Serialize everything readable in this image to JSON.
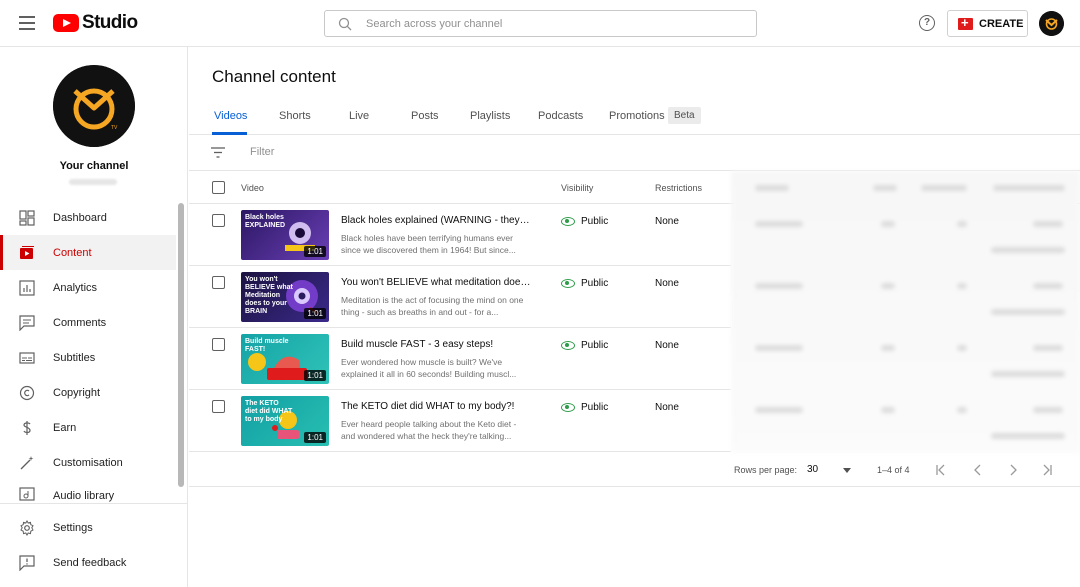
{
  "header": {
    "logo_text": "Studio",
    "search_placeholder": "Search across your channel",
    "create_label": "CREATE",
    "help_glyph": "?"
  },
  "sidebar": {
    "channel_name": "Your channel",
    "items": [
      {
        "label": "Dashboard",
        "icon": "dashboard-icon"
      },
      {
        "label": "Content",
        "icon": "content-icon",
        "active": true
      },
      {
        "label": "Analytics",
        "icon": "analytics-icon"
      },
      {
        "label": "Comments",
        "icon": "comments-icon"
      },
      {
        "label": "Subtitles",
        "icon": "subtitles-icon"
      },
      {
        "label": "Copyright",
        "icon": "copyright-icon"
      },
      {
        "label": "Earn",
        "icon": "earn-icon"
      },
      {
        "label": "Customisation",
        "icon": "customisation-icon"
      },
      {
        "label": "Audio library",
        "icon": "audio-library-icon"
      }
    ],
    "bottom_items": [
      {
        "label": "Settings",
        "icon": "gear-icon"
      },
      {
        "label": "Send feedback",
        "icon": "feedback-icon"
      }
    ]
  },
  "main": {
    "title": "Channel content",
    "tabs": [
      "Videos",
      "Shorts",
      "Live",
      "Posts",
      "Playlists",
      "Podcasts",
      "Promotions"
    ],
    "beta_label": "Beta",
    "filter_placeholder": "Filter",
    "columns": {
      "video": "Video",
      "visibility": "Visibility",
      "restrictions": "Restrictions"
    },
    "videos": [
      {
        "title": "Black holes explained (WARNING - they're t...",
        "description": "Black holes have been terrifying humans ever since we discovered them in 1964! But since...",
        "visibility": "Public",
        "restrictions": "None",
        "duration": "1:01",
        "thumb_text": "Black holes EXPLAINED",
        "thumb_color": "#3a1f7a"
      },
      {
        "title": "You won't BELIEVE what meditation does t...",
        "description": "Meditation is the act of focusing the mind on one thing - such as breaths in and out - for a...",
        "visibility": "Public",
        "restrictions": "None",
        "duration": "1:01",
        "thumb_text": "You won't BELIEVE what Meditation does to your BRAIN",
        "thumb_color": "#2a1a5e"
      },
      {
        "title": "Build muscle FAST - 3 easy steps!",
        "description": "Ever wondered how muscle is built? We've explained it all in 60 seconds! Building muscl...",
        "visibility": "Public",
        "restrictions": "None",
        "duration": "1:01",
        "thumb_text": "Build muscle FAST!",
        "thumb_color": "#1aa0a8"
      },
      {
        "title": "The KETO diet did WHAT to my body?!",
        "description": "Ever heard people talking about the Keto diet - and wondered what the heck they're talking...",
        "visibility": "Public",
        "restrictions": "None",
        "duration": "1:01",
        "thumb_text": "The KETO diet did WHAT to my body",
        "thumb_color": "#17a6a8"
      }
    ],
    "pagination": {
      "rows_label": "Rows per page:",
      "rows_value": "30",
      "range": "1–4 of 4"
    }
  },
  "colors": {
    "accent_red": "#cc0000",
    "tab_blue": "#065fd4",
    "public_green": "#2e9c4a",
    "brand_orange": "#f5a623"
  }
}
